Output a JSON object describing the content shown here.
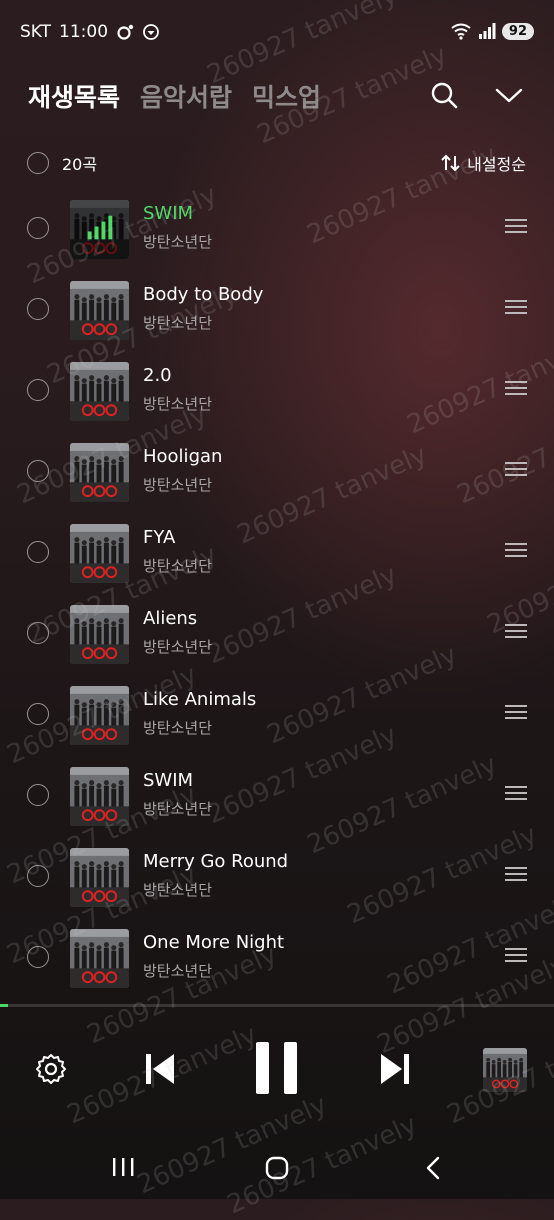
{
  "status": {
    "carrier": "SKT",
    "time": "11:00",
    "battery": "92"
  },
  "tabs": [
    {
      "label": "재생목록"
    },
    {
      "label": "음악서랍"
    },
    {
      "label": "믹스업"
    }
  ],
  "count_label": "20곡",
  "sort_label": "내설정순",
  "tracks": [
    {
      "title": "SWIM",
      "artist": "방탄소년단"
    },
    {
      "title": "Body to Body",
      "artist": "방탄소년단"
    },
    {
      "title": "2.0",
      "artist": "방탄소년단"
    },
    {
      "title": "Hooligan",
      "artist": "방탄소년단"
    },
    {
      "title": "FYA",
      "artist": "방탄소년단"
    },
    {
      "title": "Aliens",
      "artist": "방탄소년단"
    },
    {
      "title": "Like Animals",
      "artist": "방탄소년단"
    },
    {
      "title": "SWIM",
      "artist": "방탄소년단"
    },
    {
      "title": "Merry Go Round",
      "artist": "방탄소년단"
    },
    {
      "title": "One More Night",
      "artist": "방탄소년단"
    }
  ],
  "now_playing_index": 0,
  "progress": 0.015,
  "watermark": "260927 tanvely",
  "colors": {
    "accent": "#4cd964"
  }
}
